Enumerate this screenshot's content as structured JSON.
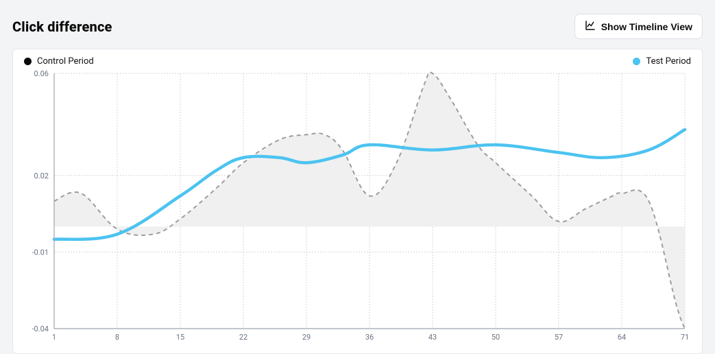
{
  "header": {
    "title": "Click difference",
    "timeline_button": "Show Timeline View"
  },
  "legend": {
    "control": {
      "label": "Control Period",
      "color": "#0b0b0b"
    },
    "test": {
      "label": "Test Period",
      "color": "#4cc3f0"
    }
  },
  "chart_data": {
    "type": "line",
    "title": "Click difference",
    "xlabel": "",
    "ylabel": "",
    "x_ticks": [
      1,
      8,
      15,
      22,
      29,
      36,
      43,
      50,
      57,
      64,
      71
    ],
    "y_ticks": [
      -0.04,
      -0.01,
      0.02,
      0.06
    ],
    "xlim": [
      1,
      71
    ],
    "ylim": [
      -0.04,
      0.06
    ],
    "grid": true,
    "legend_position": "top",
    "series": [
      {
        "name": "Control Period",
        "style": "dashed-area",
        "color": "#9d9d9d",
        "area_baseline": 0.0,
        "x": [
          1,
          4,
          8,
          12,
          15,
          19,
          22,
          26,
          29,
          31,
          33,
          36,
          39,
          42,
          43,
          45,
          48,
          50,
          54,
          57,
          60,
          63,
          64,
          67,
          70,
          71
        ],
        "values": [
          0.01,
          0.013,
          -0.001,
          -0.003,
          0.003,
          0.015,
          0.025,
          0.034,
          0.036,
          0.036,
          0.03,
          0.012,
          0.025,
          0.055,
          0.06,
          0.05,
          0.032,
          0.025,
          0.012,
          0.002,
          0.007,
          0.012,
          0.013,
          0.01,
          -0.03,
          -0.04
        ]
      },
      {
        "name": "Test Period",
        "style": "solid",
        "color": "#4cc3f0",
        "x": [
          1,
          8,
          15,
          19,
          22,
          26,
          29,
          33,
          36,
          43,
          50,
          57,
          62,
          67,
          71
        ],
        "values": [
          -0.005,
          -0.003,
          0.012,
          0.022,
          0.027,
          0.027,
          0.025,
          0.028,
          0.032,
          0.03,
          0.032,
          0.029,
          0.027,
          0.03,
          0.038
        ]
      }
    ]
  }
}
